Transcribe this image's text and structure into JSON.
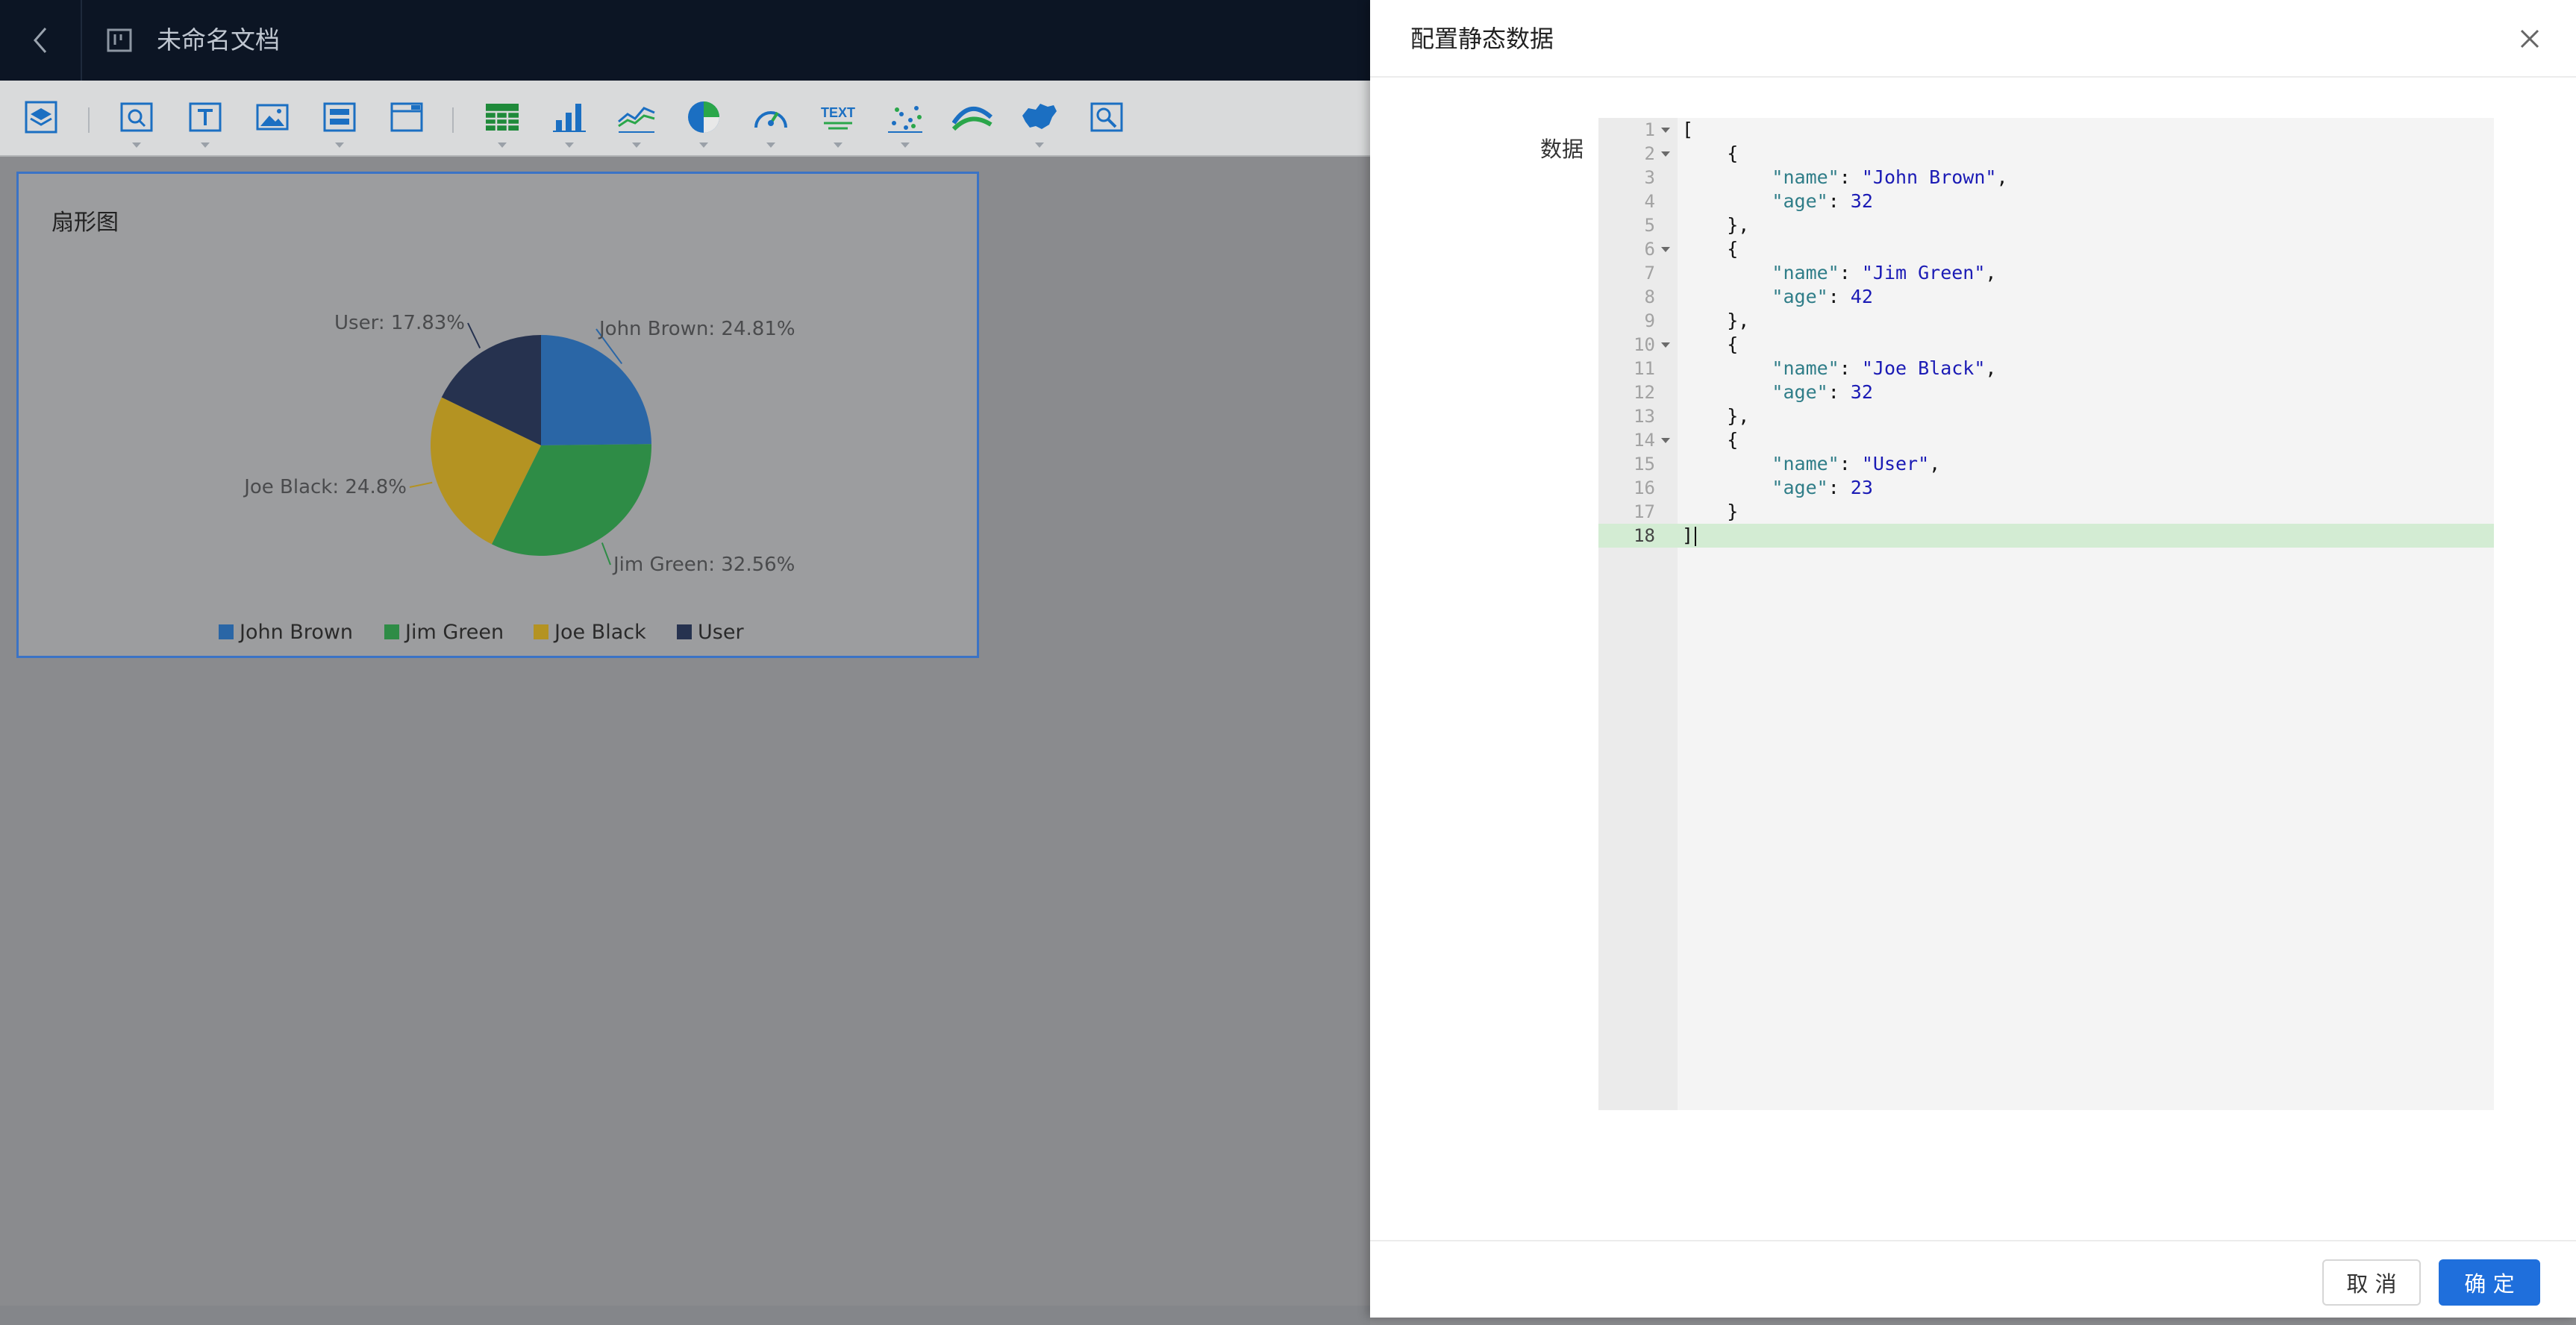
{
  "header": {
    "doc_title": "未命名文档"
  },
  "toolbar": {
    "tools": [
      "layers-icon",
      "search-box-icon",
      "text-icon",
      "image-icon",
      "layout-icon",
      "window-icon",
      "table-icon",
      "bar-chart-icon",
      "line-chart-icon",
      "pie-chart-icon",
      "gauge-icon",
      "text-widget-icon",
      "scatter-icon",
      "flow-icon",
      "map-china-icon",
      "inspect-icon"
    ],
    "text_widget_label": "TEXT"
  },
  "chart_data": {
    "type": "pie",
    "title": "扇形图",
    "categories": [
      "John Brown",
      "Jim Green",
      "Joe Black",
      "User"
    ],
    "values": [
      32,
      42,
      32,
      23
    ],
    "percent_labels": [
      "John Brown: 24.81%",
      "Jim Green: 32.56%",
      "Joe Black: 24.8%",
      "User: 17.83%"
    ],
    "colors": [
      "#2a66a6",
      "#2e8c46",
      "#b49322",
      "#26324f"
    ],
    "legend_placement": "bottom"
  },
  "dialog": {
    "title": "配置静态数据",
    "field_label": "数据",
    "cancel_label": "取 消",
    "ok_label": "确 定",
    "editor_lines": [
      "[",
      "    {",
      "        \"name\": \"John Brown\",",
      "        \"age\": 32",
      "    },",
      "    {",
      "        \"name\": \"Jim Green\",",
      "        \"age\": 42",
      "    },",
      "    {",
      "        \"name\": \"Joe Black\",",
      "        \"age\": 32",
      "    },",
      "    {",
      "        \"name\": \"User\",",
      "        \"age\": 23",
      "    }",
      "]"
    ],
    "foldable_lines": [
      1,
      2,
      6,
      10,
      14
    ],
    "active_line": 18
  }
}
